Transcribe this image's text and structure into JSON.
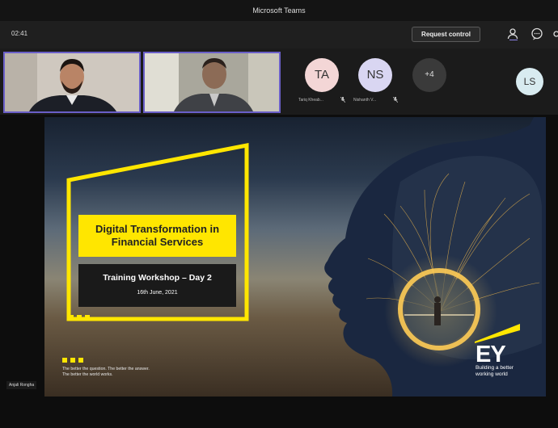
{
  "window": {
    "title": "Microsoft Teams"
  },
  "toolbar": {
    "timer": "02:41",
    "request_control": "Request control"
  },
  "participants": {
    "tiles": [
      {
        "initials": "TA",
        "name": "Tariq Kheab...",
        "color": "#f3d6d6"
      },
      {
        "initials": "NS",
        "name": "Nishanth V...",
        "color": "#d9d6f2"
      },
      {
        "initials": "+4",
        "color": "#3a3a3a"
      },
      {
        "initials": "LS",
        "color": "#d8ebf0"
      }
    ]
  },
  "presenter": {
    "name": "Anjali Rongha"
  },
  "slide": {
    "title": "Digital Transformation in Financial Services",
    "subtitle": "Training Workshop – Day 2",
    "date": "16th June, 2021",
    "tagline_1": "The better the question. The better the answer.",
    "tagline_2": "The better the world works.",
    "logo": "EY",
    "logo_tagline_1": "Building a better",
    "logo_tagline_2": "working world",
    "accent": "#ffe600"
  }
}
